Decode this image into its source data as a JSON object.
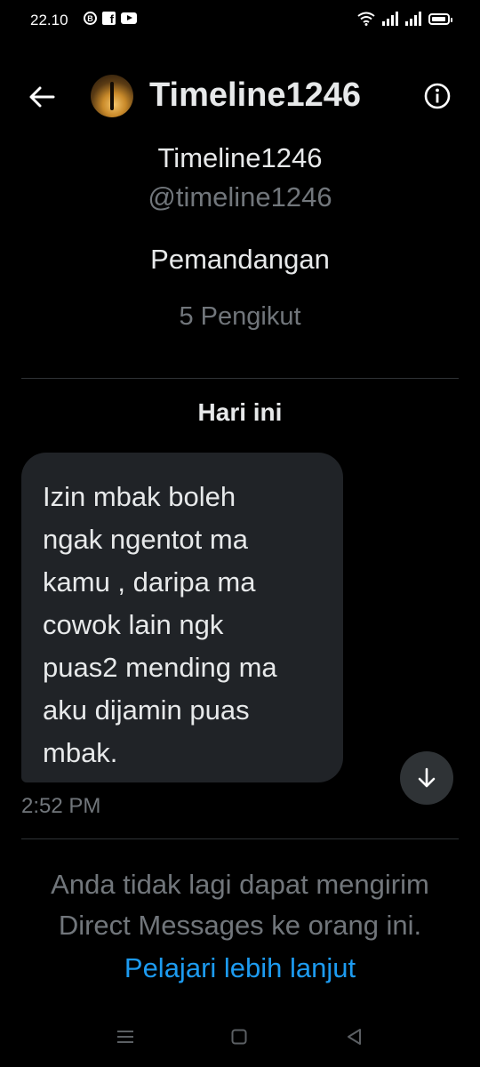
{
  "status_bar": {
    "time": "22.10",
    "notifications": [
      "b-circle-icon",
      "facebook-icon",
      "youtube-icon"
    ],
    "indicators": [
      "wifi-icon",
      "signal-icon",
      "signal-icon",
      "battery-icon"
    ]
  },
  "header": {
    "title": "Timeline1246",
    "back_icon": "arrow-left-icon",
    "info_icon": "info-icon"
  },
  "profile": {
    "name": "Timeline1246",
    "handle": "@timeline1246",
    "bio": "Pemandangan",
    "followers": "5 Pengikut"
  },
  "conversation": {
    "date_label": "Hari ini",
    "messages": [
      {
        "lines": [
          "Izin mbak boleh",
          "ngak ngentot ma",
          "kamu , daripa ma",
          "cowok lain ngk",
          "puas2 mending ma",
          "aku dijamin puas",
          "mbak."
        ],
        "time": "2:52 PM"
      }
    ]
  },
  "footer": {
    "notice_line1": "Anda tidak lagi dapat mengirim",
    "notice_line2": "Direct Messages ke orang ini.",
    "learn_more": "Pelajari lebih lanjut"
  },
  "colors": {
    "background": "#000000",
    "bubble": "#202327",
    "primary_text": "#e7e9ea",
    "secondary_text": "#71767b",
    "link": "#1d9bf0",
    "divider": "#2f3336"
  }
}
